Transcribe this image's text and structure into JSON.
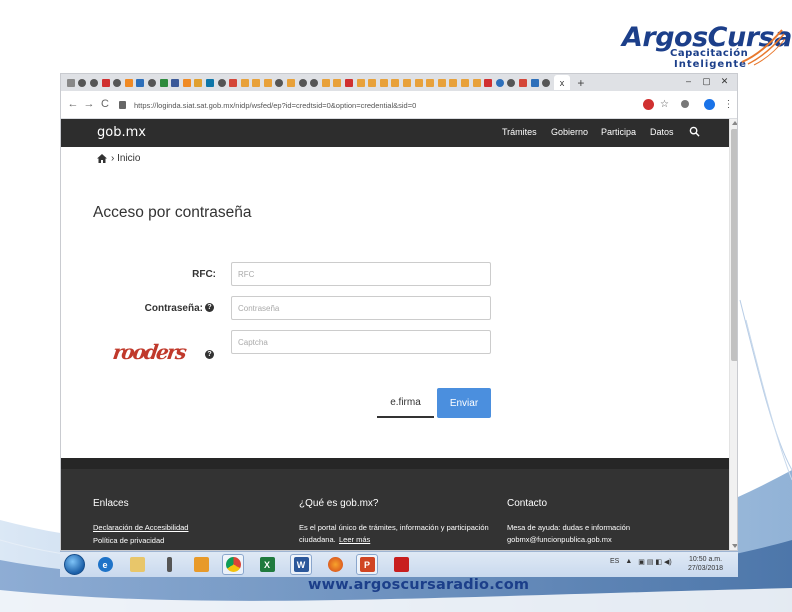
{
  "logo": {
    "brand": "ArgosCursa",
    "line1": "Capacitación",
    "line2": "Inteligente"
  },
  "website": "www.argoscursaradio.com",
  "browser": {
    "active_tab_close": "x",
    "new_tab": "+",
    "address": "https://loginda.siat.sat.gob.mx/nidp/wsfed/ep?id=credtsid=0&option=credential&sid=0",
    "back": "←",
    "forward": "→",
    "reload": "C"
  },
  "site": {
    "logo": "gob.mx",
    "nav": [
      "Trámites",
      "Gobierno",
      "Participa",
      "Datos"
    ]
  },
  "breadcrumb": "› Inicio",
  "page_title": "Acceso por contraseña",
  "form": {
    "rfc_label": "RFC:",
    "rfc_placeholder": "RFC",
    "password_label": "Contraseña:",
    "password_placeholder": "Contraseña",
    "captcha_text": "rooders",
    "captcha_placeholder": "Captcha",
    "help_glyph": "?",
    "efirma_label": "e.firma",
    "submit_label": "Enviar"
  },
  "footer": {
    "col1_title": "Enlaces",
    "col1_links": [
      "Declaración de Accesibilidad",
      "Política de privacidad"
    ],
    "col2_title": "¿Qué es gob.mx?",
    "col2_text": [
      "Es el portal único de trámites, información y participación",
      "ciudadana."
    ],
    "col2_link": "Leer más",
    "col3_title": "Contacto",
    "col3_text": [
      "Mesa de ayuda: dudas e información",
      "gobmx@funcionpublica.gob.mx"
    ]
  },
  "taskbar": {
    "tray": [
      "ES",
      "▲"
    ],
    "time": "10:50 a.m.",
    "date": "27/03/2018"
  },
  "colors": {
    "header_bg": "#2d2d2d",
    "footer_bg": "#333333",
    "submit_bg": "#4b8fde",
    "captcha": "#c0392b",
    "brand_blue": "#1c3f8a",
    "brand_orange": "#e8782d"
  }
}
